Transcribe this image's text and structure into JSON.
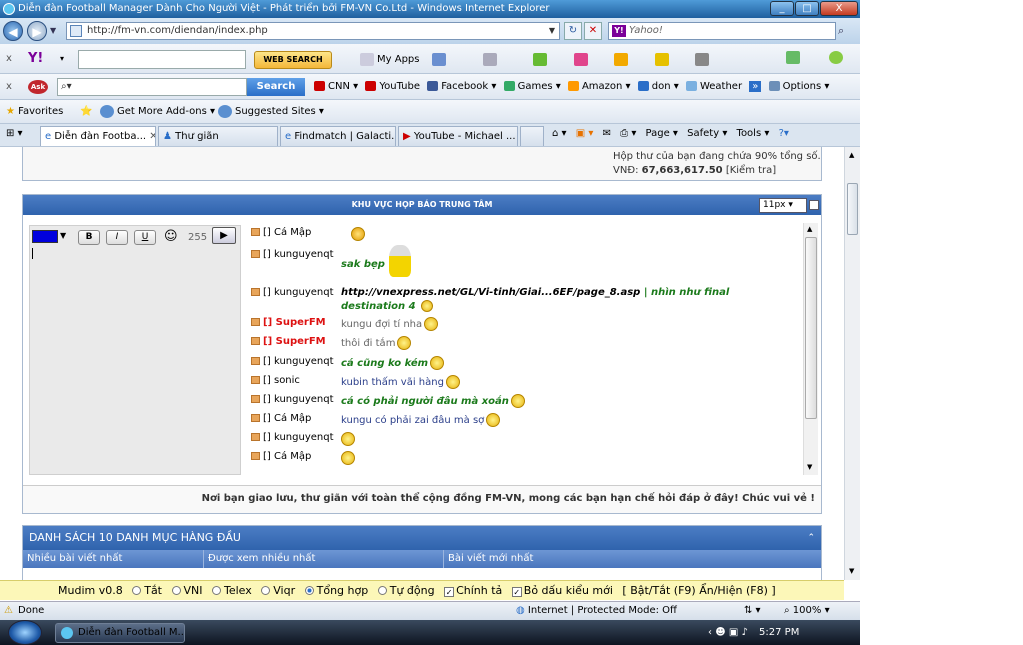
{
  "window": {
    "title": "Diễn đàn Football Manager Dành Cho Người Việt - Phát triển bởi FM-VN Co.Ltd - Windows Internet Explorer",
    "min": "_",
    "max": "□",
    "close": "X"
  },
  "address": {
    "url": "http://fm-vn.com/diendan/index.php",
    "search_placeholder": "Yahoo!"
  },
  "yahoo_toolbar": {
    "web_search": "WEB SEARCH",
    "my_apps": "My Apps"
  },
  "ask_toolbar": {
    "search_button": "Search",
    "items": [
      "CNN ▾",
      "YouTube",
      "Facebook ▾",
      "Games ▾",
      "Amazon ▾",
      "don ▾",
      "Weather",
      "Options ▾"
    ]
  },
  "favorites_bar": {
    "favorites": "Favorites",
    "get_more_addons": "Get More Add-ons ▾",
    "suggested_sites": "Suggested Sites ▾"
  },
  "tabs": [
    {
      "label": "Diễn đàn Footba..."
    },
    {
      "label": "Thư giãn"
    },
    {
      "label": "Findmatch | Galacti..."
    },
    {
      "label": "YouTube - Michael ..."
    }
  ],
  "commandbar": {
    "page": "Page ▾",
    "safety": "Safety ▾",
    "tools": "Tools ▾"
  },
  "mailbox": {
    "line1": "Hộp thư của bạn đang chứa 90% tổng số.",
    "vnd_label": "VNĐ:",
    "vnd_value": "67,663,617.50",
    "check": "[Kiểm tra]"
  },
  "chat": {
    "title": "KHU VỰC HỌP BÁO TRUNG TÂM",
    "font_size": "11px",
    "char_count": "255",
    "footer": "Nơi bạn giao lưu, thư giãn với toàn thể cộng đồng FM-VN, mong các bạn hạn chế hỏi đáp ở đây! Chúc vui vẻ !",
    "messages": [
      {
        "user": "[] Cá Mập",
        "text": ""
      },
      {
        "user": "[] kunguyenqt",
        "text": "sak bẹp"
      },
      {
        "user": "[] kunguyenqt",
        "text": "http://vnexpress.net/GL/Vi-tinh/Giai...6EF/page_8.asp",
        "sep": " | ",
        "text2": "nhìn như final",
        "text3": "destination 4"
      },
      {
        "user": "[] SuperFM",
        "text": "kungu đợi tí nha"
      },
      {
        "user": "[] SuperFM",
        "text": "thôi đi tắm"
      },
      {
        "user": "[] kunguyenqt",
        "text": "cá cũng ko kém"
      },
      {
        "user": "[] sonic",
        "text": "kubin thấm vãi hàng"
      },
      {
        "user": "[] kunguyenqt",
        "text": "cá có phải người đâu mà xoắn"
      },
      {
        "user": "[] Cá Mập",
        "text": "kungu có phải zai đâu mà sợ"
      },
      {
        "user": "[] kunguyenqt",
        "text": ""
      },
      {
        "user": "[] Cá Mập",
        "text": ""
      }
    ]
  },
  "top10": {
    "title": "DANH SÁCH 10 DANH MỤC HÀNG ĐẦU",
    "columns": [
      "Nhiều bài viết nhất",
      "Được xem nhiều nhất",
      "Bài viết mới nhất"
    ]
  },
  "mudim": {
    "name": "Mudim v0.8",
    "options": [
      "Tắt",
      "VNI",
      "Telex",
      "Viqr",
      "Tổng hợp",
      "Tự động"
    ],
    "selected": "Tổng hợp",
    "check1": "Chính tả",
    "check2": "Bỏ dấu kiểu mới",
    "hint": "[ Bật/Tắt (F9) Ẩn/Hiện (F8) ]"
  },
  "statusbar": {
    "done": "Done",
    "zone": "Internet | Protected Mode: Off",
    "zoom": "100%"
  },
  "taskbar": {
    "task": "Diễn đàn Football M...",
    "time": "5:27 PM"
  },
  "colors": {
    "chat_header": "#2f63ad",
    "green_msg": "#1b7a1b",
    "superfm": "#dd1111",
    "mudim_bg": "#fcf7b8"
  }
}
